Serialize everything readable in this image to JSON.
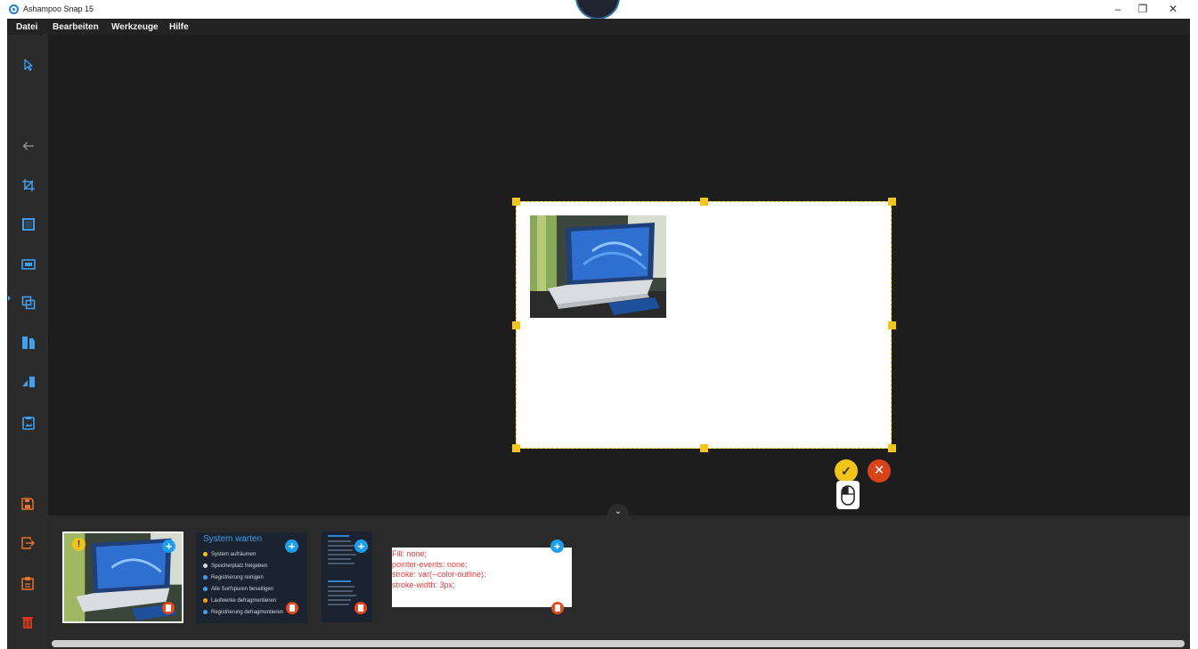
{
  "window": {
    "title": "Ashampoo Snap 15",
    "minimize_glyph": "–",
    "restore_glyph": "❐",
    "close_glyph": "✕",
    "icon": "app-logo-icon"
  },
  "menu": {
    "items": [
      "Datei",
      "Bearbeiten",
      "Werkzeuge",
      "Hilfe"
    ]
  },
  "toolbar": {
    "tools": [
      {
        "name": "select-tool",
        "icon": "cursor-icon"
      },
      {
        "name": "back-tool",
        "icon": "arrow-left-icon"
      },
      {
        "name": "crop-tool",
        "icon": "crop-icon"
      },
      {
        "name": "canvas-tool",
        "icon": "square-icon"
      },
      {
        "name": "resize-tool",
        "icon": "frame-icon"
      },
      {
        "name": "overlay-tool",
        "icon": "overlap-icon"
      },
      {
        "name": "layout-tool",
        "icon": "layout-icon"
      },
      {
        "name": "perspective-tool",
        "icon": "perspective-icon"
      },
      {
        "name": "picture-tool",
        "icon": "picture-frame-icon"
      }
    ],
    "save_tools": [
      {
        "name": "save-button",
        "icon": "floppy-icon"
      },
      {
        "name": "export-button",
        "icon": "export-icon"
      },
      {
        "name": "clipboard-button",
        "icon": "clipboard-icon"
      },
      {
        "name": "delete-button",
        "icon": "trash-icon"
      }
    ],
    "panel_toggle_glyph": "›",
    "accent": "#3ea0ef",
    "save_accent": "#e8732a"
  },
  "canvas": {
    "confirm_glyph": "✓",
    "cancel_glyph": "✕",
    "collapse_glyph": "⌄",
    "handle_color": "#f5c518"
  },
  "tray": {
    "thumbnails": [
      {
        "type": "photo",
        "warn_glyph": "!",
        "add_glyph": "+"
      },
      {
        "type": "list",
        "title": "System warten",
        "add_glyph": "+",
        "items": [
          {
            "label": "System aufräumen",
            "color": "#f2c318"
          },
          {
            "label": "Speicherplatz freigeben",
            "color": "#cfd8e3"
          },
          {
            "label": "Registrierung reinigen",
            "color": "#3ea0ef"
          },
          {
            "label": "Alle Surfspuren beseitigen",
            "color": "#3ea0ef"
          },
          {
            "label": "Laufwerke defragmentieren",
            "color": "#f2a018"
          },
          {
            "label": "Registrierung defragmentieren",
            "color": "#3ea0ef"
          }
        ]
      },
      {
        "type": "mini-list",
        "add_glyph": "+"
      },
      {
        "type": "code",
        "add_glyph": "+",
        "lines": [
          "Fill: none;",
          "pointer-events: none;",
          "stroke: var(--color-outline);",
          "stroke-width: 3px;"
        ]
      }
    ]
  }
}
